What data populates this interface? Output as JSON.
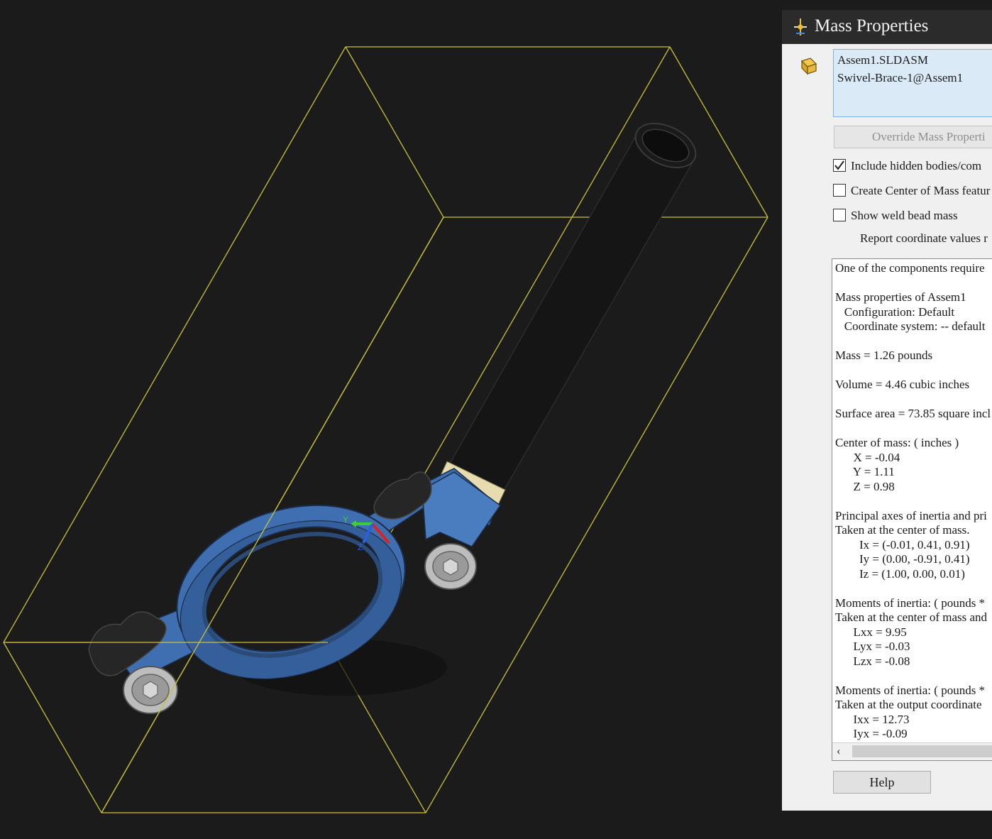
{
  "dialog": {
    "title": "Mass Properties",
    "selection": [
      "Assem1.SLDASM",
      "Swivel-Brace-1@Assem1"
    ],
    "override_button": "Override Mass Properti",
    "checkboxes": [
      {
        "label": "Include hidden bodies/com",
        "checked": true
      },
      {
        "label": "Create Center of Mass featur",
        "checked": false
      },
      {
        "label": "Show weld bead mass",
        "checked": false
      }
    ],
    "report_note": "Report coordinate values r",
    "results_lines": [
      "One of the components require",
      "",
      "Mass properties of Assem1",
      "   Configuration: Default",
      "   Coordinate system: -- default",
      "",
      "Mass = 1.26 pounds",
      "",
      "Volume = 4.46 cubic inches",
      "",
      "Surface area = 73.85 square incl",
      "",
      "Center of mass: ( inches )",
      "      X = -0.04",
      "      Y = 1.11",
      "      Z = 0.98",
      "",
      "Principal axes of inertia and pri",
      "Taken at the center of mass.",
      "        Ix = (-0.01, 0.41, 0.91)",
      "        Iy = (0.00, -0.91, 0.41)",
      "        Iz = (1.00, 0.00, 0.01)",
      "",
      "Moments of inertia: ( pounds * ",
      "Taken at the center of mass and",
      "      Lxx = 9.95",
      "      Lyx = -0.03",
      "      Lzx = -0.08",
      "",
      "Moments of inertia: ( pounds * ",
      "Taken at the output coordinate",
      "      Ixx = 12.73",
      "      Iyx = -0.09"
    ],
    "help_button": "Help"
  },
  "triad": {
    "y_label": "Y",
    "z_label": "Z"
  },
  "colors": {
    "background": "#1b1b1b",
    "bounding_box": "#c9c23a",
    "part_blue": "#3f6fb0",
    "tube": "#141414",
    "sleeve": "#e6dcb0",
    "selection_bg": "#dbeaf7"
  },
  "icons": [
    "mass-properties-icon",
    "assembly-component-icon",
    "checkmark-icon",
    "scroll-left-icon"
  ]
}
